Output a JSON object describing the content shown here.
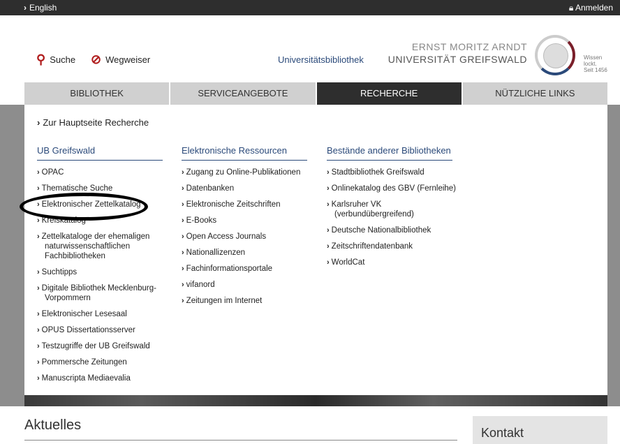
{
  "topbar": {
    "language": "English",
    "login": "Anmelden"
  },
  "header": {
    "search": "Suche",
    "guide": "Wegweiser",
    "library_link": "Universitätsbibliothek",
    "university_line1": "ERNST MORITZ ARNDT",
    "university_line2": "UNIVERSITÄT GREIFSWALD",
    "motto_line1": "Wissen",
    "motto_line2": "lockt.",
    "motto_line3": "Seit 1456"
  },
  "nav": {
    "tabs": [
      "BIBLIOTHEK",
      "SERVICEANGEBOTE",
      "RECHERCHE",
      "NÜTZLICHE LINKS"
    ],
    "active": "RECHERCHE"
  },
  "panel": {
    "main_link": "Zur Hauptseite Recherche",
    "columns": [
      {
        "heading": "UB Greifswald",
        "items": [
          "OPAC",
          "Thematische Suche",
          "Elektronischer Zettelkatalog",
          "Kreiskatalog",
          "Zettelkataloge der ehemaligen naturwissenschaftlichen Fachbibliotheken",
          "Suchtipps",
          "Digitale Bibliothek Mecklenburg-Vorpommern",
          "Elektronischer Lesesaal",
          "OPUS Dissertationsserver",
          "Testzugriffe der UB Greifswald",
          "Pommersche Zeitungen",
          "Manuscripta Mediaevalia"
        ]
      },
      {
        "heading": "Elektronische Ressourcen",
        "items": [
          "Zugang zu Online-Publikationen",
          "Datenbanken",
          "Elektronische Zeitschriften",
          "E-Books",
          "Open Access Journals",
          "Nationallizenzen",
          "Fachinformationsportale",
          "vifanord",
          "Zeitungen im Internet"
        ]
      },
      {
        "heading": "Bestände anderer Bibliotheken",
        "items": [
          "Stadtbibliothek Greifswald",
          "Onlinekatalog des GBV (Fernleihe)",
          "Karlsruher VK (verbundübergreifend)",
          "Deutsche Nationalbibliothek",
          "Zeitschriftendatenbank",
          "WorldCat"
        ]
      }
    ]
  },
  "bottom": {
    "news_heading": "Aktuelles",
    "contact_heading": "Kontakt"
  },
  "colors": {
    "accent_red": "#b01c1c",
    "link_blue": "#2b4a7a",
    "dark_bar": "#2e2e2e"
  },
  "icons": {
    "search": "search-icon",
    "guide": "compass-icon",
    "login": "lock-icon"
  }
}
